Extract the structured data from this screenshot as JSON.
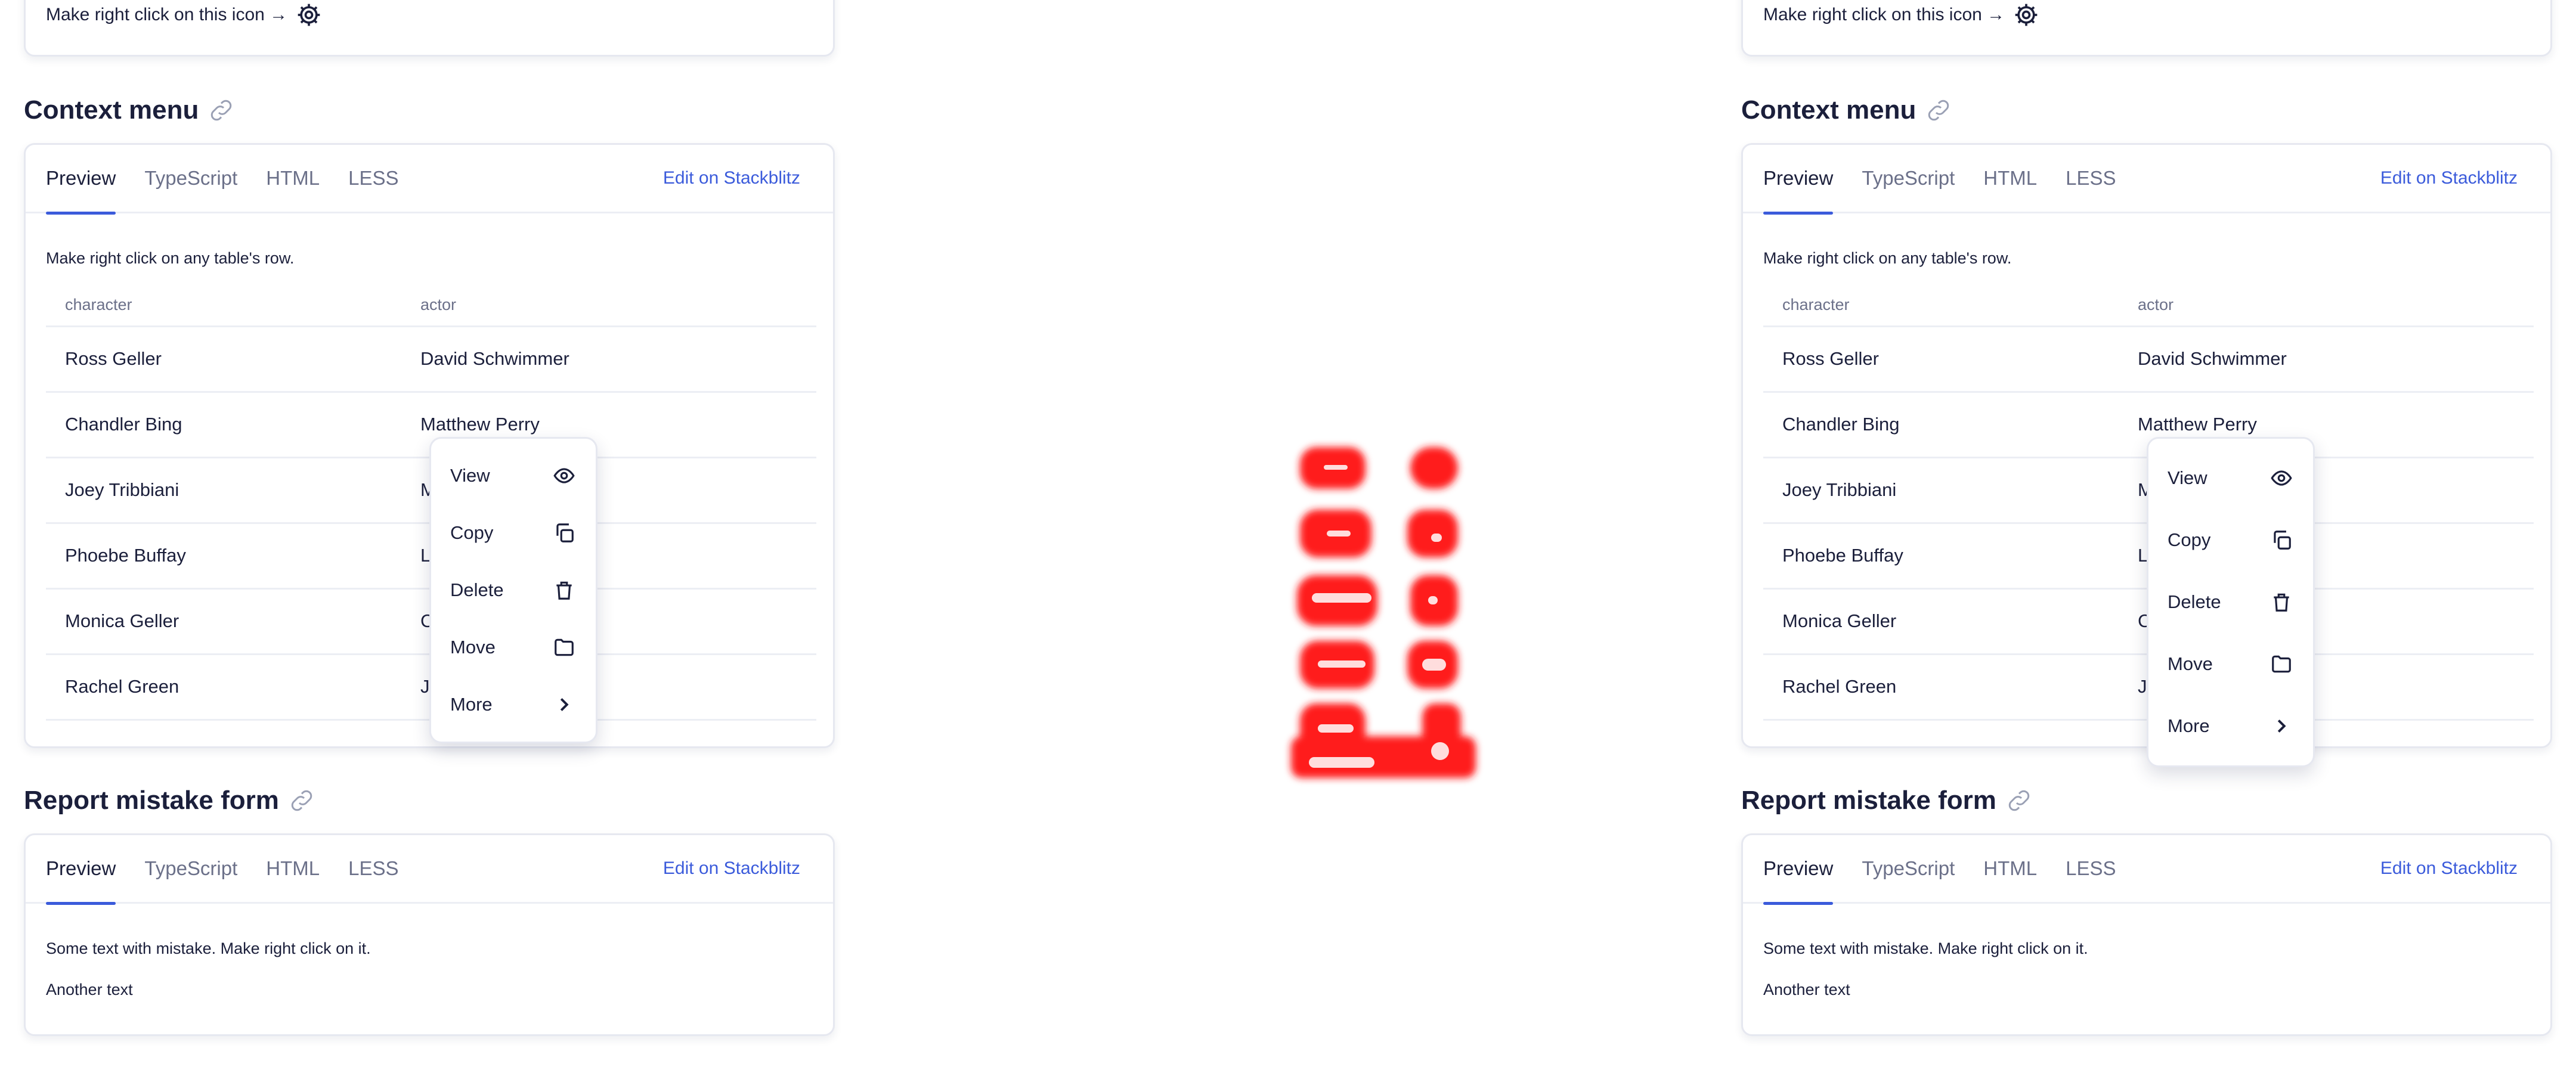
{
  "top": {
    "hint": "Make right click on this icon →"
  },
  "context_section": {
    "title": "Context menu",
    "tabs": [
      "Preview",
      "TypeScript",
      "HTML",
      "LESS"
    ],
    "edit_link": "Edit on Stackblitz",
    "intro": "Make right click on any table's row.",
    "columns": [
      "character",
      "actor"
    ],
    "rows": [
      {
        "character": "Ross Geller",
        "actor": "David Schwimmer"
      },
      {
        "character": "Chandler Bing",
        "actor": "Matthew Perry"
      },
      {
        "character": "Joey Tribbiani",
        "actor": "M"
      },
      {
        "character": "Phoebe Buffay",
        "actor": "Li"
      },
      {
        "character": "Monica Geller",
        "actor": "C"
      },
      {
        "character": "Rachel Green",
        "actor": "Je"
      }
    ]
  },
  "context_menu": {
    "items": [
      {
        "label": "View",
        "icon": "eye-icon"
      },
      {
        "label": "Copy",
        "icon": "copy-icon"
      },
      {
        "label": "Delete",
        "icon": "trash-icon"
      },
      {
        "label": "Move",
        "icon": "folder-icon"
      },
      {
        "label": "More",
        "icon": "chevron-right-icon"
      }
    ]
  },
  "report_section": {
    "title": "Report mistake form",
    "tabs": [
      "Preview",
      "TypeScript",
      "HTML",
      "LESS"
    ],
    "edit_link": "Edit on Stackblitz",
    "line1": "Some text with mistake. Make right click on it.",
    "line2": "Another text"
  },
  "colors": {
    "accent": "#3b5bdb",
    "text": "#1b1f3b",
    "muted": "#6b7089",
    "logo_red": "#ff1a1a"
  }
}
